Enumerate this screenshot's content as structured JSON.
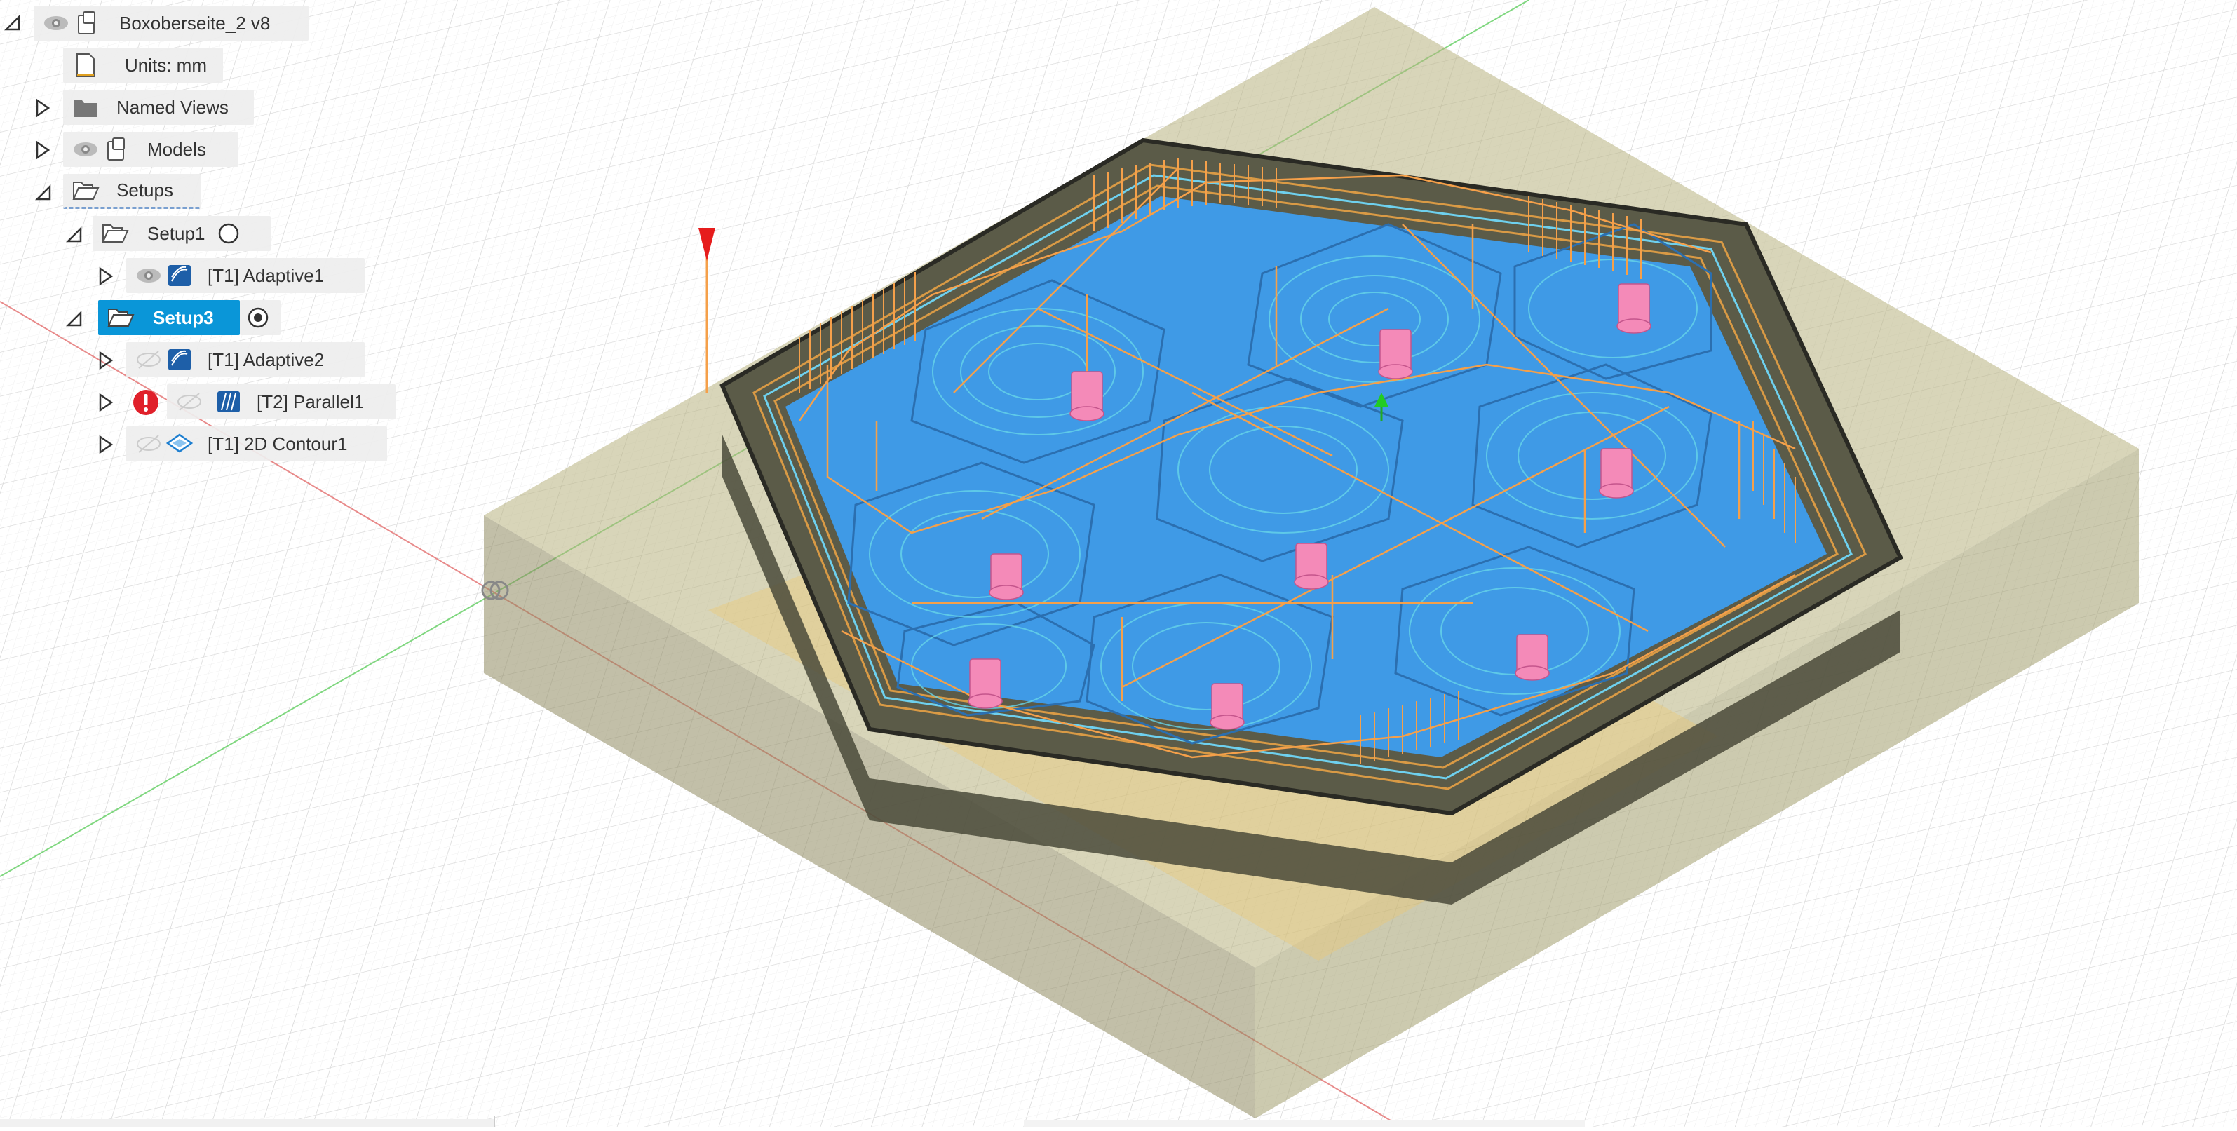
{
  "browser": {
    "root": {
      "label": "Boxoberseite_2 v8"
    },
    "units": {
      "label": "Units: mm"
    },
    "named_views": {
      "label": "Named Views"
    },
    "models": {
      "label": "Models"
    },
    "setups": {
      "label": "Setups",
      "setup1": {
        "label": "Setup1",
        "ops": [
          {
            "label": "[T1] Adaptive1"
          }
        ]
      },
      "setup3": {
        "label": "Setup3",
        "ops": [
          {
            "label": "[T1] Adaptive2"
          },
          {
            "label": "[T2] Parallel1"
          },
          {
            "label": "[T1] 2D Contour1"
          }
        ]
      }
    }
  },
  "colors": {
    "selection": "#0a96d8",
    "toolpath_feed": "#5ec8e8",
    "toolpath_rapid": "#f5a04a",
    "machined_surface": "#3f9ae6",
    "drill_marks": "#f48ab8",
    "stock": "#b5b07a",
    "error": "#e0202a"
  },
  "icons": {
    "visibility": "eye-icon",
    "component": "component-icon",
    "document": "document-icon",
    "folder": "folder-icon",
    "setup": "setup-folder-icon",
    "adaptive": "adaptive-toolpath-icon",
    "parallel": "parallel-toolpath-icon",
    "contour": "contour-toolpath-icon",
    "error": "error-icon",
    "active": "active-setup-radio-icon"
  }
}
